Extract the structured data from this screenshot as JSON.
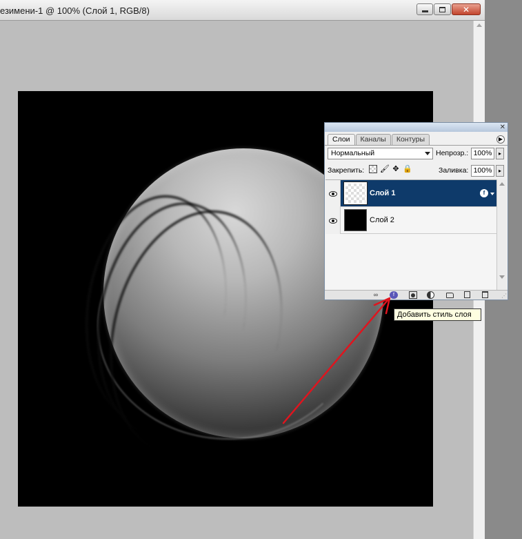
{
  "window": {
    "title": "езимени-1 @ 100% (Слой 1, RGB/8)",
    "close_glyph": "✕"
  },
  "layers_panel": {
    "close_glyph": "✕",
    "menu_glyph": "▶",
    "tabs": [
      {
        "label": "Слои",
        "active": true
      },
      {
        "label": "Каналы",
        "active": false
      },
      {
        "label": "Контуры",
        "active": false
      }
    ],
    "blend_mode": "Нормальный",
    "opacity_label": "Непрозр.:",
    "opacity_value": "100%",
    "lock_label": "Закрепить:",
    "fill_label": "Заливка:",
    "fill_value": "100%",
    "spin_glyph": "▸",
    "layers": [
      {
        "name": "Слой 1",
        "selected": true,
        "visible": true,
        "has_effects": true
      },
      {
        "name": "Слой 2",
        "selected": false,
        "visible": true,
        "has_effects": false
      }
    ],
    "fx_glyph": "f",
    "footer_icons": [
      "link-icon",
      "fx-style-icon",
      "mask-icon",
      "adjust-icon",
      "folder-icon",
      "new-layer-icon",
      "trash-icon"
    ]
  },
  "tooltip": {
    "text": "Добавить стиль слоя"
  },
  "colors": {
    "selected_layer": "#0e3a6a",
    "annotation_arrow": "#e0141e",
    "tooltip_bg": "#ffffe1"
  }
}
